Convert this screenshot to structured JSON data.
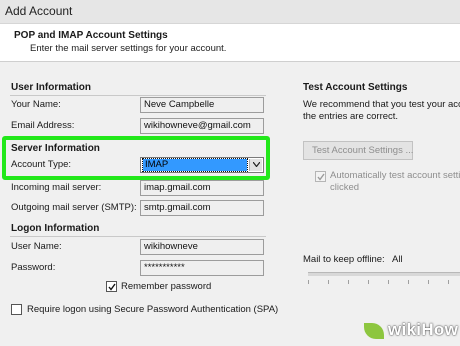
{
  "window": {
    "title": "Add Account"
  },
  "header": {
    "title": "POP and IMAP Account Settings",
    "subtitle": "Enter the mail server settings for your account."
  },
  "user_info": {
    "heading": "User Information",
    "name_label": "Your Name:",
    "name_value": "Neve Campbelle",
    "email_label": "Email Address:",
    "email_value": "wikihowneve@gmail.com"
  },
  "server_info": {
    "heading": "Server Information",
    "account_type_label": "Account Type:",
    "account_type_value": "IMAP",
    "incoming_label": "Incoming mail server:",
    "incoming_value": "imap.gmail.com",
    "outgoing_label": "Outgoing mail server (SMTP):",
    "outgoing_value": "smtp.gmail.com",
    "highlight_color": "#22e81a"
  },
  "logon_info": {
    "heading": "Logon Information",
    "username_label": "User Name:",
    "username_value": "wikihowneve",
    "password_label": "Password:",
    "password_value": "***********",
    "remember_label": "Remember password",
    "remember_checked": true,
    "spa_label": "Require logon using Secure Password Authentication (SPA)",
    "spa_checked": false
  },
  "test_settings": {
    "heading": "Test Account Settings",
    "desc_line1": "We recommend that you test your acc",
    "desc_line2": "the entries are correct.",
    "button_label": "Test Account Settings ...",
    "auto_test_line1": "Automatically test account setting",
    "auto_test_line2": "clicked",
    "auto_test_checked": true
  },
  "offline": {
    "label": "Mail to keep offline:",
    "value": "All"
  },
  "watermark": {
    "text": "wikiHow"
  },
  "icons": {
    "dropdown": "chevron-down-icon",
    "check": "checkmark-icon"
  }
}
